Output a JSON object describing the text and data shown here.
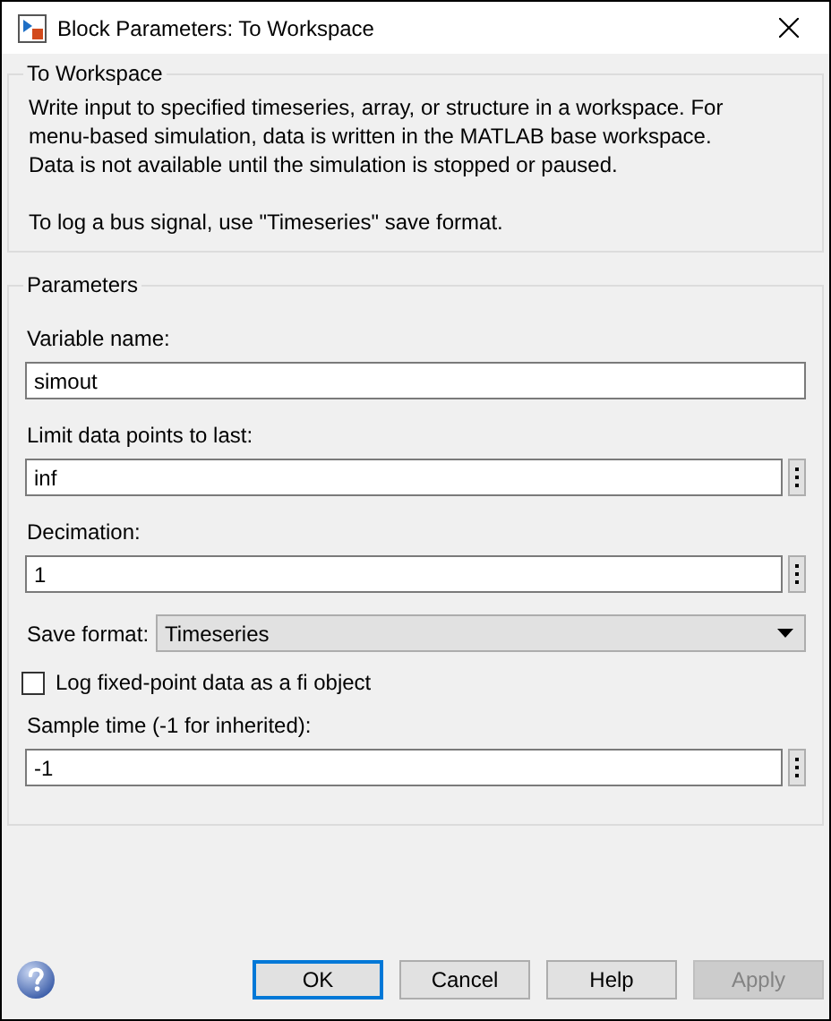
{
  "window": {
    "title": "Block Parameters: To Workspace"
  },
  "description": {
    "title": "To Workspace",
    "paragraphs": [
      [
        "Write input to specified timeseries, array, or structure in a workspace. For",
        "menu-based simulation, data is written in the MATLAB base workspace.",
        "Data is not available until the simulation is stopped or paused."
      ],
      [
        "To log a bus signal, use \"Timeseries\" save format."
      ]
    ]
  },
  "parameters": {
    "title": "Parameters",
    "items": [
      {
        "kind": "text",
        "label": "Variable name:",
        "value": "simout",
        "menu_button": false
      },
      {
        "kind": "text",
        "label": "Limit data points to last:",
        "value": "inf",
        "menu_button": true
      },
      {
        "kind": "text",
        "label": "Decimation:",
        "value": "1",
        "menu_button": true
      },
      {
        "kind": "dropdown",
        "label": "Save format:",
        "value": "Timeseries"
      },
      {
        "kind": "checkbox",
        "label": "Log fixed-point data as a fi object",
        "checked": false
      },
      {
        "kind": "text",
        "label": "Sample time (-1 for inherited):",
        "value": "-1",
        "menu_button": true
      }
    ]
  },
  "buttons": [
    {
      "label": "OK",
      "default": true,
      "disabled": false
    },
    {
      "label": "Cancel",
      "default": false,
      "disabled": false
    },
    {
      "label": "Help",
      "default": false,
      "disabled": false
    },
    {
      "label": "Apply",
      "default": false,
      "disabled": true
    }
  ]
}
